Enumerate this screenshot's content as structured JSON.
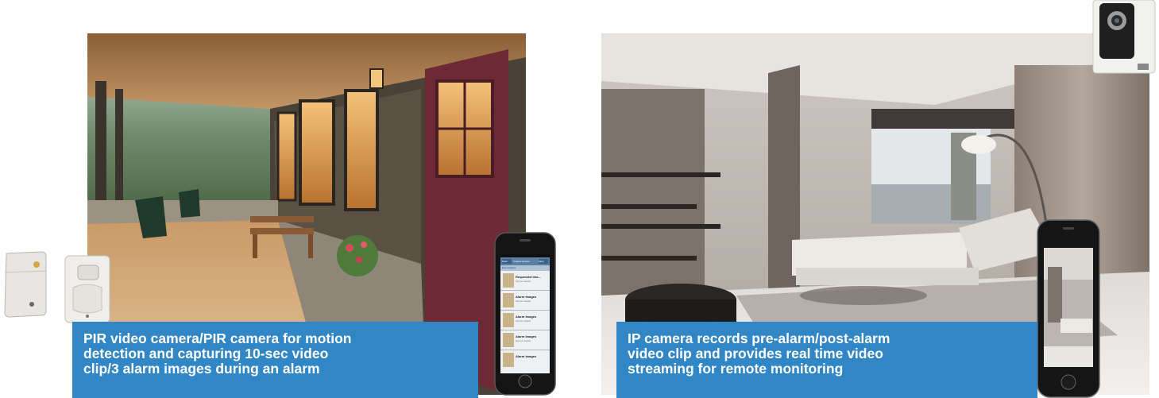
{
  "left_scene": {
    "caption": "PIR video camera/PIR camera for motion detection and capturing 10-sec video clip/3 alarm images during an alarm",
    "caption_lines": [
      "PIR video camera/PIR camera for motion",
      "detection and capturing 10-sec video",
      "clip/3 alarm images during an alarm"
    ],
    "phone_app": {
      "back_label": "Back",
      "title": "Capture Events",
      "more_label": "More",
      "subheader": "Event History",
      "items": [
        {
          "title": "Requested Ima...",
          "subtitle": "Sensor details"
        },
        {
          "title": "Alarm Images",
          "subtitle": "Sensor details"
        },
        {
          "title": "Alarm Images",
          "subtitle": "Sensor details"
        },
        {
          "title": "Alarm Images",
          "subtitle": "Sensor details"
        },
        {
          "title": "Alarm Images",
          "subtitle": ""
        }
      ]
    }
  },
  "right_scene": {
    "caption": "IP camera records pre-alarm/post-alarm video clip and provides real time video streaming for remote monitoring",
    "caption_lines": [
      "IP camera records pre-alarm/post-alarm",
      "video clip and provides real time video",
      "streaming for remote monitoring"
    ]
  },
  "colors": {
    "caption_bg": "#3186c6",
    "caption_text": "#ffffff",
    "door": "#6e2a34",
    "wood_ceiling": "#a77a4c",
    "sofa": "#ece9e4"
  }
}
